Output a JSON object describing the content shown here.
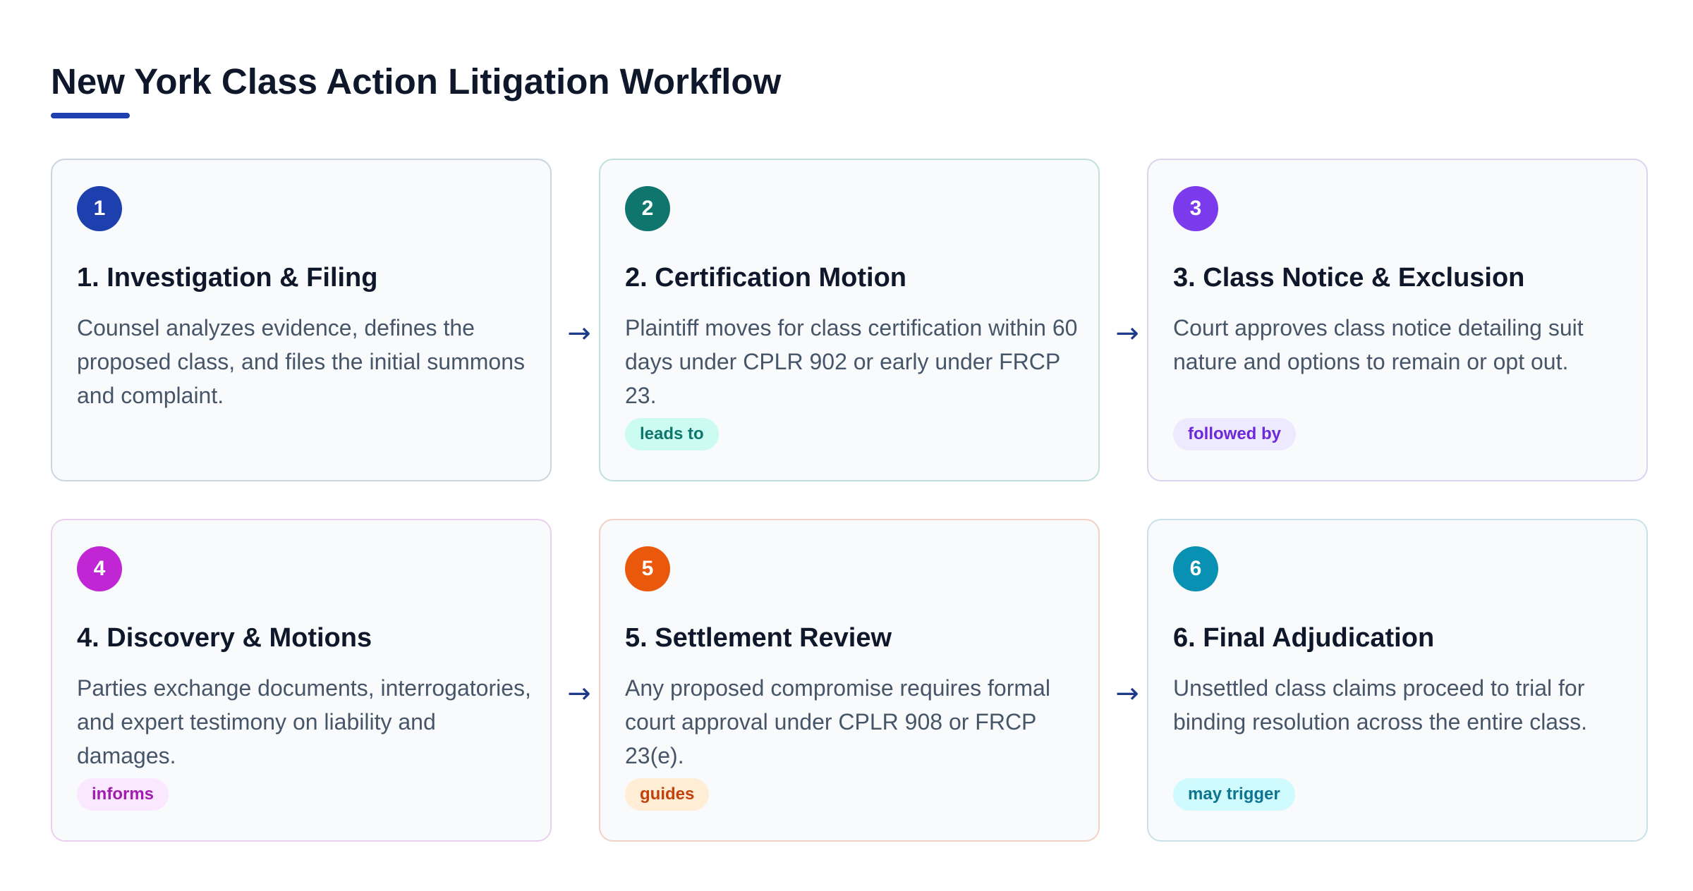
{
  "title": "New York Class Action Litigation Workflow",
  "arrow_glyph": "→",
  "steps": [
    {
      "number": "1",
      "title": "1. Investigation & Filing",
      "description": "Counsel analyzes evidence, defines the proposed class, and files the initial summons and complaint.",
      "relation": "",
      "accent": "#1e40af",
      "border": "#cbd5e1"
    },
    {
      "number": "2",
      "title": "2. Certification Motion",
      "description": "Plaintiff moves for class certification within 60 days under CPLR 902 or early under FRCP 23.",
      "relation": "leads to",
      "accent": "#0f766e",
      "border": "#bfe0dc",
      "tag_bg": "#ccfbf1",
      "tag_fg": "#0f766e"
    },
    {
      "number": "3",
      "title": "3. Class Notice & Exclusion",
      "description": "Court approves class notice detailing suit nature and options to remain or opt out.",
      "relation": "followed by",
      "accent": "#7c3aed",
      "border": "#dcd3ee",
      "tag_bg": "#ede9fe",
      "tag_fg": "#6d28d9"
    },
    {
      "number": "4",
      "title": "4. Discovery & Motions",
      "description": "Parties exchange documents, interrogatories, and expert testimony on liability and damages.",
      "relation": "informs",
      "accent": "#c026d3",
      "border": "#ead0ee",
      "tag_bg": "#fae8ff",
      "tag_fg": "#a21caf"
    },
    {
      "number": "5",
      "title": "5. Settlement Review",
      "description": "Any proposed compromise requires formal court approval under CPLR 908 or FRCP 23(e).",
      "relation": "guides",
      "accent": "#ea580c",
      "border": "#f2d2c6",
      "tag_bg": "#ffedd5",
      "tag_fg": "#c2410c"
    },
    {
      "number": "6",
      "title": "6. Final Adjudication",
      "description": "Unsettled class claims proceed to trial for binding resolution across the entire class.",
      "relation": "may trigger",
      "accent": "#0891b2",
      "border": "#c9e1e8",
      "tag_bg": "#cffafe",
      "tag_fg": "#0e7490"
    }
  ]
}
